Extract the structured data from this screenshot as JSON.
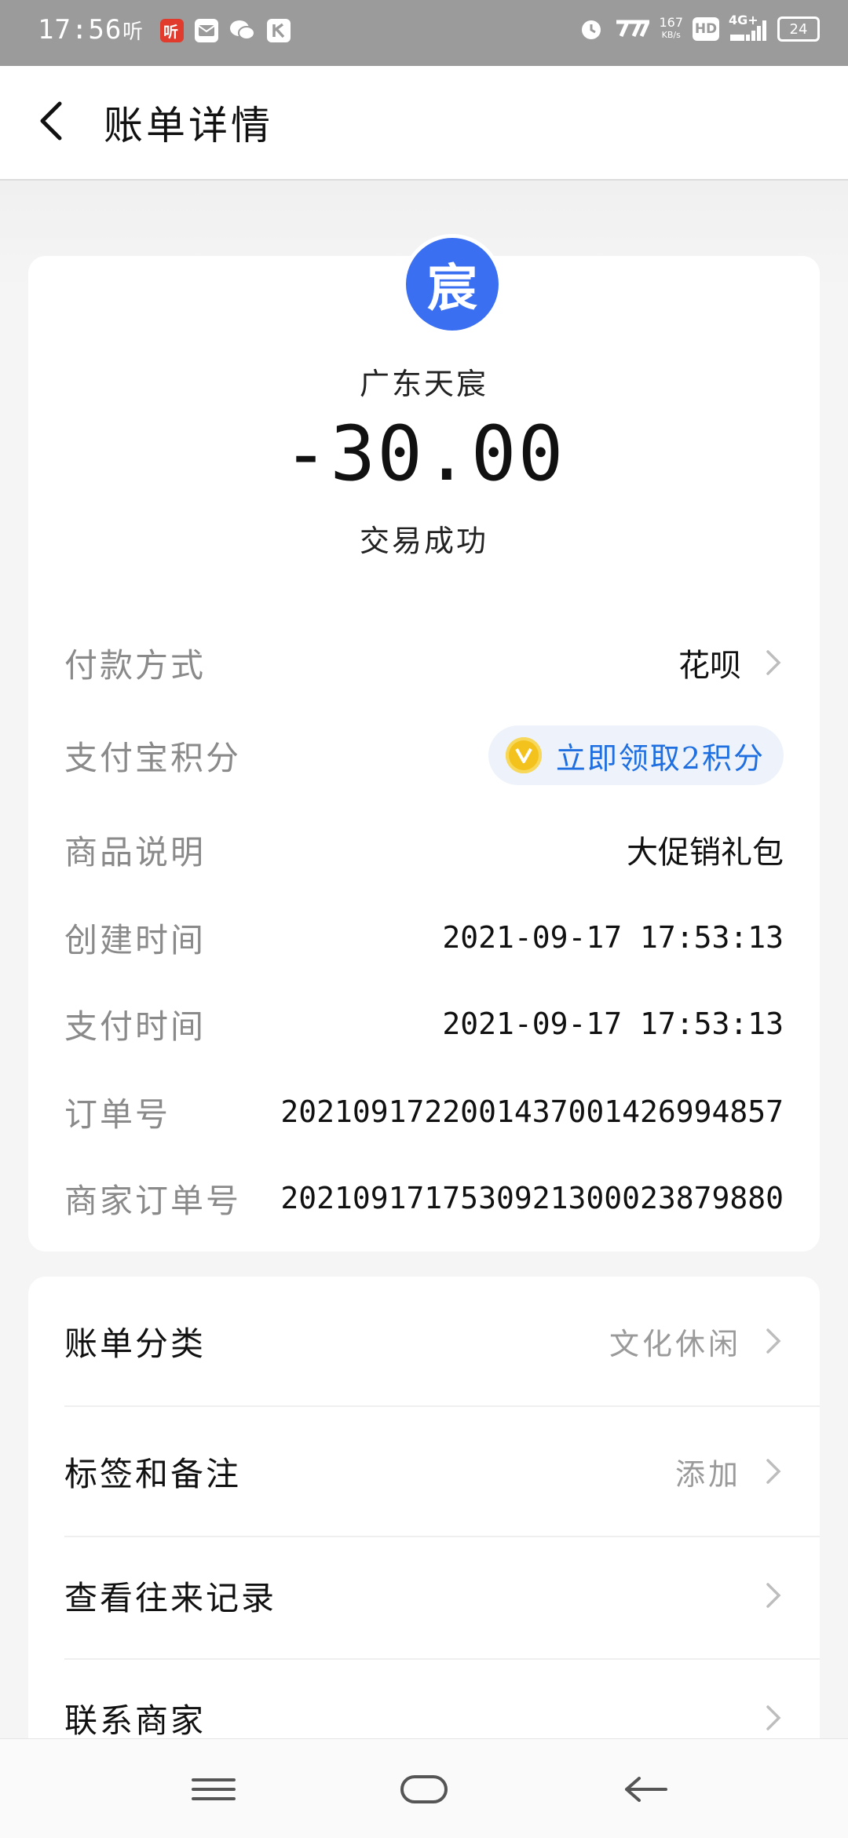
{
  "status_bar": {
    "time": "17:56",
    "left_icons": [
      "ting-icon",
      "ting-red-icon",
      "mail-icon",
      "wechat-icon",
      "k-icon"
    ],
    "net_speed_value": "167",
    "net_speed_unit": "KB/s",
    "hd_label": "HD",
    "network_label": "4G+",
    "battery": "24"
  },
  "header": {
    "title": "账单详情"
  },
  "summary": {
    "avatar_char": "宸",
    "merchant": "广东天宸",
    "amount": "-30.00",
    "status": "交易成功"
  },
  "details": [
    {
      "label": "付款方式",
      "value": "花呗",
      "has_chevron": true
    },
    {
      "label": "支付宝积分",
      "value": "立即领取2积分",
      "badge": true
    },
    {
      "label": "商品说明",
      "value": "大促销礼包"
    },
    {
      "label": "创建时间",
      "value": "2021-09-17 17:53:13"
    },
    {
      "label": "支付时间",
      "value": "2021-09-17 17:53:13"
    },
    {
      "label": "订单号",
      "value": "2021091722001437001426994857"
    },
    {
      "label": "商家订单号",
      "value": "2021091717530921300023879880"
    }
  ],
  "actions": [
    {
      "label": "账单分类",
      "aux": "文化休闲"
    },
    {
      "label": "标签和备注",
      "aux": "添加"
    },
    {
      "label": "查看往来记录",
      "aux": ""
    },
    {
      "label": "联系商家",
      "aux": ""
    }
  ],
  "colors": {
    "accent_blue": "#1f6fe0",
    "avatar_blue": "#3a6ff2",
    "coin_gold": "#f3c21d",
    "status_bar_bg": "#9b9b9b"
  }
}
